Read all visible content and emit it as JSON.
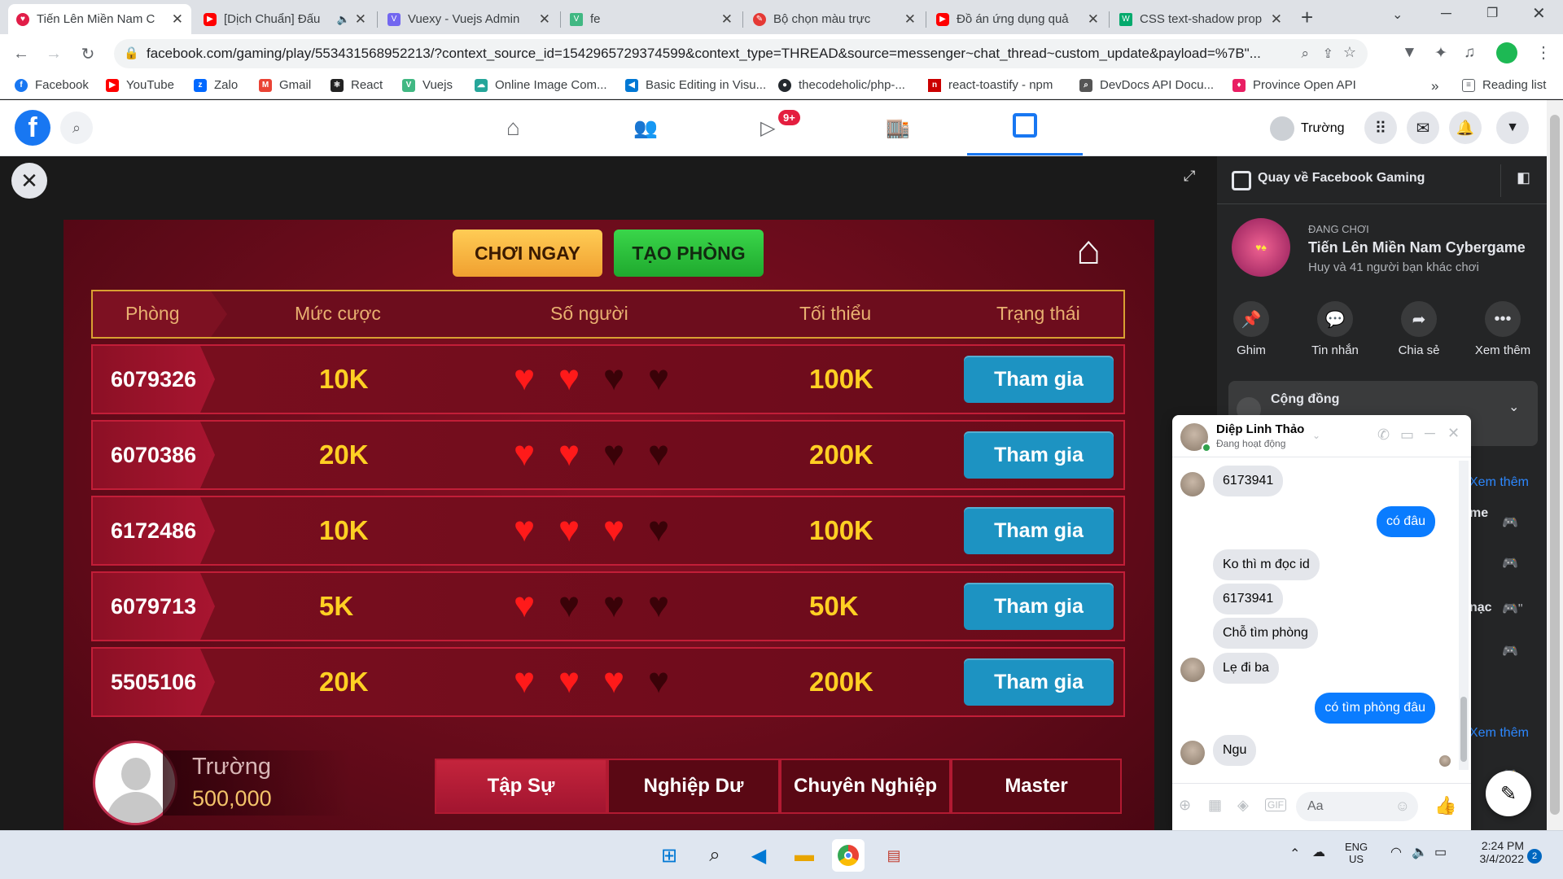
{
  "browser": {
    "tabs": [
      {
        "title": "Tiến Lên Miền Nam C",
        "color": "#e11d48",
        "icon": "game-icon"
      },
      {
        "title": "[Dịch Chuẩn] Đấu",
        "color": "#ff0000",
        "icon": "youtube-icon"
      },
      {
        "title": "Vuexy - Vuejs Admin",
        "color": "#7367f0",
        "icon": "vuexy-icon"
      },
      {
        "title": "fe",
        "color": "#41b883",
        "icon": "vue-icon"
      },
      {
        "title": "Bộ chọn màu trực",
        "color": "#e53935",
        "icon": "color-picker-icon"
      },
      {
        "title": "Đồ án ứng dụng quả",
        "color": "#ff0000",
        "icon": "youtube-icon"
      },
      {
        "title": "CSS text-shadow prop",
        "color": "#04aa6d",
        "icon": "w3schools-icon"
      }
    ],
    "url": "facebook.com/gaming/play/553431568952213/?context_source_id=1542965729374599&context_type=THREAD&source=messenger~chat_thread~custom_update&payload=%7B\"..."
  },
  "bookmarks": [
    {
      "label": "Facebook",
      "color": "#1877f2"
    },
    {
      "label": "YouTube",
      "color": "#ff0000"
    },
    {
      "label": "Zalo",
      "color": "#0068ff"
    },
    {
      "label": "Gmail",
      "color": "#ea4335"
    },
    {
      "label": "React",
      "color": "#222"
    },
    {
      "label": "Vuejs",
      "color": "#41b883"
    },
    {
      "label": "Online Image Com...",
      "color": "#26a69a"
    },
    {
      "label": "Basic Editing in Visu...",
      "color": "#0078d4"
    },
    {
      "label": "thecodeholic/php-...",
      "color": "#24292e"
    },
    {
      "label": "react-toastify - npm",
      "color": "#cb0000"
    },
    {
      "label": "DevDocs API Docu...",
      "color": "#555"
    },
    {
      "label": "Province Open API",
      "color": "#e91e63"
    }
  ],
  "bookmarks_more": "»",
  "reading_list": "Reading list",
  "fb": {
    "user": "Trường",
    "video_badge": "9+"
  },
  "game": {
    "play_now": "CHƠI NGAY",
    "create_room": "TẠO PHÒNG",
    "headers": [
      "Phòng",
      "Mức cược",
      "Số người",
      "Tối thiểu",
      "Trạng thái"
    ],
    "rooms": [
      {
        "id": "6079326",
        "bet": "10K",
        "players": 2,
        "min": "100K",
        "join": "Tham gia"
      },
      {
        "id": "6070386",
        "bet": "20K",
        "players": 2,
        "min": "200K",
        "join": "Tham gia"
      },
      {
        "id": "6172486",
        "bet": "10K",
        "players": 3,
        "min": "100K",
        "join": "Tham gia"
      },
      {
        "id": "6079713",
        "bet": "5K",
        "players": 1,
        "min": "50K",
        "join": "Tham gia"
      },
      {
        "id": "5505106",
        "bet": "20K",
        "players": 3,
        "min": "200K",
        "join": "Tham gia"
      }
    ],
    "player_name": "Trường",
    "player_money": "500,000",
    "levels": [
      "Tập Sự",
      "Nghiệp Dư",
      "Chuyên Nghiệp",
      "Master"
    ],
    "active_level": "Tập Sự"
  },
  "panel": {
    "back": "Quay về Facebook Gaming",
    "playing_label": "ĐANG CHƠI",
    "game_title": "Tiến Lên Miền Nam Cybergame",
    "game_sub": "Huy và 41 người bạn khác chơi",
    "actions": [
      "Ghim",
      "Tin nhắn",
      "Chia sẻ",
      "Xem thêm"
    ],
    "community": "Cộng đồng",
    "see_more_1": "Xem thêm",
    "see_more_2": "Xem thêm",
    "partial_1": "me",
    "partial_2": "nạc"
  },
  "chat": {
    "name": "Diệp Linh Thảo",
    "status": "Đang hoạt động",
    "messages": [
      {
        "text": "6173941",
        "dir": "in"
      },
      {
        "text": "có đâu",
        "dir": "out"
      },
      {
        "text": "Ko thì m đọc id",
        "dir": "in"
      },
      {
        "text": "6173941",
        "dir": "in"
      },
      {
        "text": "Chỗ tìm phòng",
        "dir": "in"
      },
      {
        "text": "Lẹ đi ba",
        "dir": "in"
      },
      {
        "text": "có tìm phòng đâu",
        "dir": "out"
      },
      {
        "text": "Ngu",
        "dir": "in"
      }
    ],
    "input_placeholder": "Aa"
  },
  "taskbar": {
    "lang": "ENG",
    "region": "US",
    "time": "2:24 PM",
    "date": "3/4/2022",
    "notifications": "2"
  }
}
